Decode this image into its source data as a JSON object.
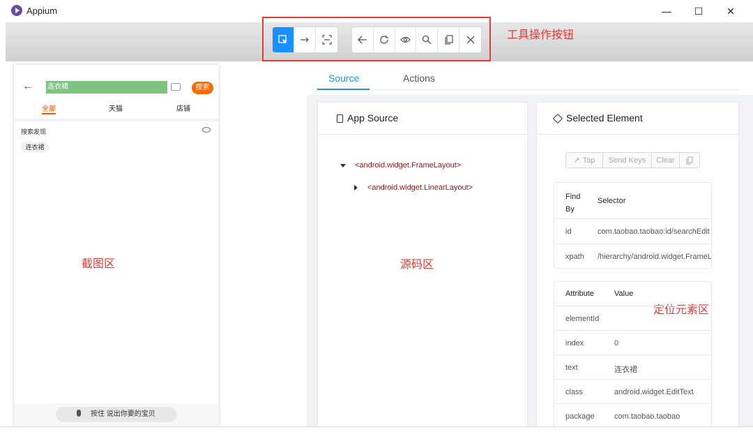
{
  "window": {
    "title": "Appium",
    "minimize": "—",
    "maximize": "☐",
    "close": "✕"
  },
  "toolbar": {
    "mode_buttons": [
      "select-icon",
      "swipe-icon",
      "tap-coordinates-icon"
    ],
    "nav_buttons": [
      "back-icon",
      "refresh-icon",
      "show-icon",
      "search-icon",
      "copy-icon",
      "close-icon"
    ],
    "annotation": "工具操作按钮"
  },
  "phone": {
    "search_text": "连衣裙",
    "search_button": "搜索",
    "tabs": [
      "全部",
      "天猫",
      "店铺"
    ],
    "discover_label": "搜索发现",
    "chip": "连衣裙",
    "voice": "按住 说出你要的宝贝"
  },
  "annotations": {
    "screenshot_area": "截图区",
    "source_area": "源码区",
    "locate_area": "定位元素区",
    "toolbar": "工具操作按钮"
  },
  "tabs": {
    "source": "Source",
    "actions": "Actions"
  },
  "app_source": {
    "title": "App Source",
    "nodes": [
      "<android.widget.FrameLayout>",
      "<android.widget.LinearLayout>"
    ]
  },
  "selected_element": {
    "title": "Selected Element",
    "buttons": [
      "Tap",
      "Send Keys",
      "Clear"
    ],
    "selector_headers": {
      "find_by": "Find By",
      "selector": "Selector"
    },
    "selectors": [
      {
        "find_by": "id",
        "selector": "com.taobao.taobao:id/searchEdit"
      },
      {
        "find_by": "xpath",
        "selector": "/hierarchy/android.widget.FrameLayout"
      }
    ],
    "attr_headers": {
      "attribute": "Attribute",
      "value": "Value"
    },
    "attributes": [
      {
        "name": "elementId",
        "value": ""
      },
      {
        "name": "index",
        "value": "0"
      },
      {
        "name": "text",
        "value": "连衣裙"
      },
      {
        "name": "class",
        "value": "android.widget.EditText"
      },
      {
        "name": "package",
        "value": "com.taobao.taobao"
      }
    ]
  },
  "colors": {
    "accent": "#1890ff",
    "annotation_red": "#e53935",
    "phone_orange": "#ff5000"
  }
}
